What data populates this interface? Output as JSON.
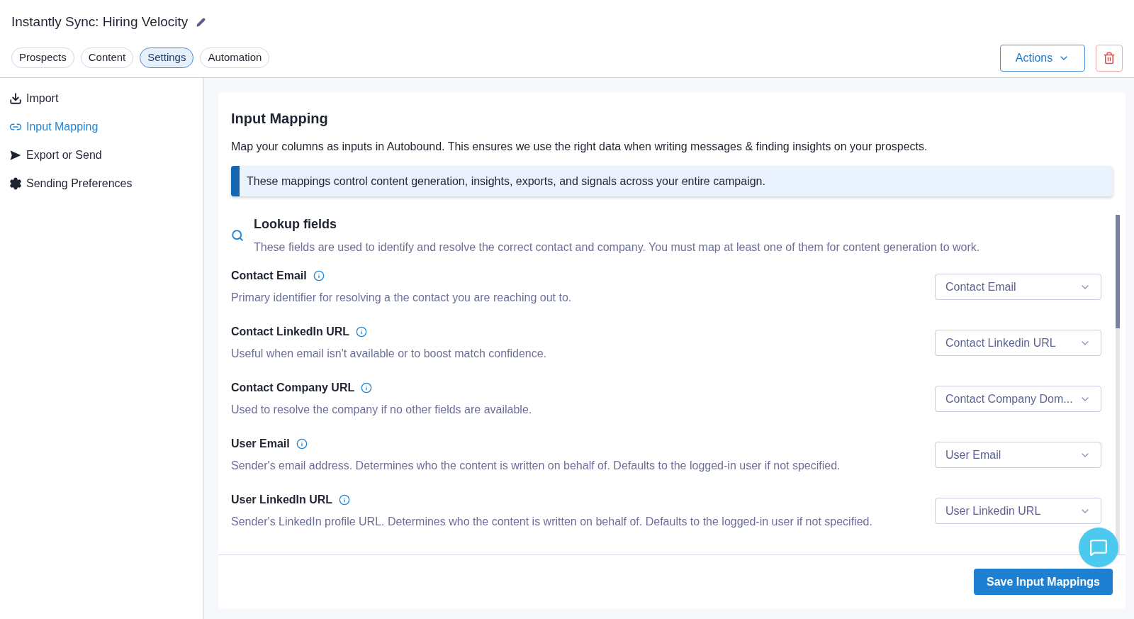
{
  "header": {
    "title": "Instantly Sync: Hiring Velocity",
    "actions_button": "Actions"
  },
  "tabs": [
    {
      "label": "Prospects",
      "selected": false
    },
    {
      "label": "Content",
      "selected": false
    },
    {
      "label": "Settings",
      "selected": true
    },
    {
      "label": "Automation",
      "selected": false
    }
  ],
  "sidebar": {
    "items": [
      {
        "label": "Import",
        "kind": "import",
        "selected": false
      },
      {
        "label": "Input Mapping",
        "kind": "link",
        "selected": true
      },
      {
        "label": "Export or Send",
        "kind": "send",
        "selected": false
      },
      {
        "label": "Sending Preferences",
        "kind": "gear",
        "selected": false
      }
    ]
  },
  "panel": {
    "title": "Input Mapping",
    "description": "Map your columns as inputs in Autobound. This ensures we use the right data when writing messages & finding insights on your prospects.",
    "notice": "These mappings control content generation, insights, exports, and signals across your entire campaign.",
    "section": {
      "title": "Lookup fields",
      "description": "These fields are used to identify and resolve the correct contact and company. You must map at least one of them for content generation to work."
    },
    "fields": [
      {
        "label": "Contact Email",
        "description": "Primary identifier for resolving a the contact you are reaching out to.",
        "value": "Contact Email"
      },
      {
        "label": "Contact LinkedIn URL",
        "description": "Useful when email isn't available or to boost match confidence.",
        "value": "Contact Linkedin URL"
      },
      {
        "label": "Contact Company URL",
        "description": "Used to resolve the company if no other fields are available.",
        "value": "Contact Company Dom..."
      },
      {
        "label": "User Email",
        "description": "Sender's email address. Determines who the content is written on behalf of. Defaults to the logged-in user if not specified.",
        "value": "User Email"
      },
      {
        "label": "User LinkedIn URL",
        "description": "Sender's LinkedIn profile URL. Determines who the content is written on behalf of. Defaults to the logged-in user if not specified.",
        "value": "User Linkedin URL"
      }
    ],
    "save_button": "Save Input Mappings"
  }
}
